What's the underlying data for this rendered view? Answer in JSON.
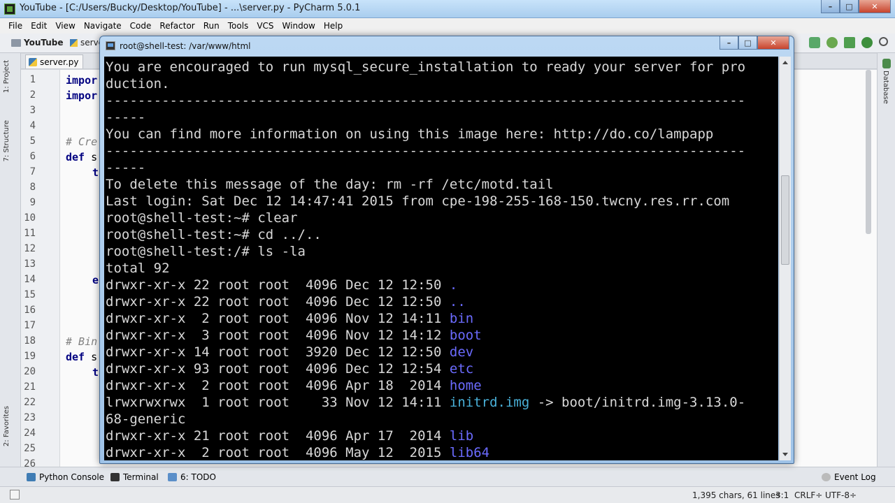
{
  "pycharm": {
    "title": "YouTube - [C:/Users/Bucky/Desktop/YouTube] - ...\\server.py - PyCharm 5.0.1",
    "menu": [
      "File",
      "Edit",
      "View",
      "Navigate",
      "Code",
      "Refactor",
      "Run",
      "Tools",
      "VCS",
      "Window",
      "Help"
    ],
    "breadcrumb": {
      "project": "YouTube",
      "file": "serve"
    },
    "file_tab": "server.py",
    "left_tools": {
      "project": "1: Project",
      "structure": "7: Structure",
      "favorites": "2: Favorites"
    },
    "right_tool": "Database",
    "line_numbers": [
      "1",
      "2",
      "3",
      "4",
      "5",
      "6",
      "7",
      "8",
      "9",
      "10",
      "11",
      "12",
      "13",
      "14",
      "15",
      "16",
      "17",
      "18",
      "19",
      "20",
      "21",
      "22",
      "23",
      "24",
      "25",
      "26"
    ],
    "code_fragments": {
      "l1": "impor",
      "l2": "impor",
      "l5": "# Cre",
      "l6_kw": "def",
      "l6_rest": " s",
      "l7": "t",
      "l14": "e",
      "l18": "# Bin",
      "l19_kw": "def",
      "l19_rest": " s",
      "l20": "t"
    },
    "bottom_tools": [
      {
        "label": "Python Console",
        "icon": "python-console-icon"
      },
      {
        "label": "Terminal",
        "icon": "terminal-icon"
      },
      {
        "label": "6: TODO",
        "icon": "todo-icon"
      }
    ],
    "event_log": "Event Log",
    "status": {
      "chars": "1,395 chars, 61 lines",
      "position": "3:1",
      "line_sep": "CRLF÷",
      "encoding": "UTF-8÷"
    }
  },
  "putty": {
    "title": "root@shell-test: /var/www/html",
    "lines": [
      "You are encouraged to run mysql_secure_installation to ready your server for pro",
      "duction.",
      "--------------------------------------------------------------------------------",
      "-----",
      "You can find more information on using this image here: http://do.co/lampapp",
      "--------------------------------------------------------------------------------",
      "-----",
      "To delete this message of the day: rm -rf /etc/motd.tail",
      "Last login: Sat Dec 12 14:47:41 2015 from cpe-198-255-168-150.twcny.res.rr.com",
      "root@shell-test:~# clear",
      "root@shell-test:~# cd ../..",
      "root@shell-test:/# ls -la",
      "total 92"
    ],
    "listing": [
      {
        "meta": "drwxr-xr-x 22 root root  4096 Dec 12 12:50 ",
        "name": ".",
        "kind": "dir"
      },
      {
        "meta": "drwxr-xr-x 22 root root  4096 Dec 12 12:50 ",
        "name": "..",
        "kind": "dir"
      },
      {
        "meta": "drwxr-xr-x  2 root root  4096 Nov 12 14:11 ",
        "name": "bin",
        "kind": "dir"
      },
      {
        "meta": "drwxr-xr-x  3 root root  4096 Nov 12 14:12 ",
        "name": "boot",
        "kind": "dir"
      },
      {
        "meta": "drwxr-xr-x 14 root root  3920 Dec 12 12:50 ",
        "name": "dev",
        "kind": "dir"
      },
      {
        "meta": "drwxr-xr-x 93 root root  4096 Dec 12 12:54 ",
        "name": "etc",
        "kind": "dir"
      },
      {
        "meta": "drwxr-xr-x  2 root root  4096 Apr 18  2014 ",
        "name": "home",
        "kind": "dir"
      },
      {
        "meta": "lrwxrwxrwx  1 root root    33 Nov 12 14:11 ",
        "name": "initrd.img",
        "kind": "link",
        "target": " -> boot/initrd.img-3.13.0-"
      },
      {
        "meta": "68-generic",
        "name": "",
        "kind": "wrap"
      },
      {
        "meta": "drwxr-xr-x 21 root root  4096 Apr 17  2014 ",
        "name": "lib",
        "kind": "dir"
      },
      {
        "meta": "drwxr-xr-x  2 root root  4096 May 12  2015 ",
        "name": "lib64",
        "kind": "dir"
      }
    ]
  },
  "colors": {
    "terminal_bg": "#000000",
    "terminal_fg": "#d8d8d8",
    "directory": "#6b6bff",
    "symlink": "#49b0d8",
    "keyword": "#000080"
  }
}
